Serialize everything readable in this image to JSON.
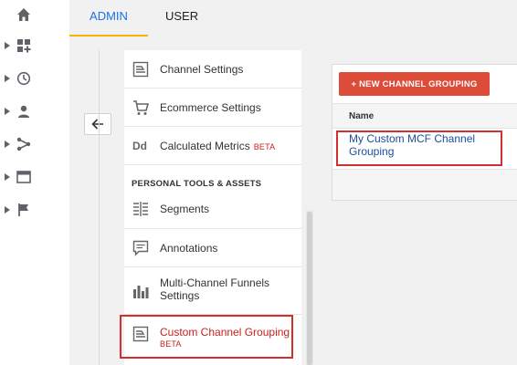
{
  "tabs": [
    {
      "label": "ADMIN",
      "active": true
    },
    {
      "label": "USER",
      "active": false
    }
  ],
  "rail": {
    "icons": [
      "home-icon",
      "dashboard-icon",
      "clock-icon",
      "person-icon",
      "share-icon",
      "display-icon",
      "flag-icon"
    ]
  },
  "menu": {
    "items": [
      {
        "label": "Channel Settings",
        "icon": "channel-settings-icon"
      },
      {
        "label": "Ecommerce Settings",
        "icon": "cart-icon"
      },
      {
        "label": "Calculated Metrics",
        "badge": "BETA",
        "icon": "dd-icon"
      }
    ],
    "section_heading": "PERSONAL TOOLS & ASSETS",
    "personal_items": [
      {
        "label": "Segments",
        "icon": "segments-icon"
      },
      {
        "label": "Annotations",
        "icon": "annotation-icon"
      },
      {
        "label": "Multi-Channel Funnels Settings",
        "icon": "bar-chart-icon"
      },
      {
        "label": "Custom Channel Grouping",
        "badge": "BETA",
        "icon": "channel-grouping-icon",
        "active": true
      }
    ]
  },
  "panel": {
    "new_button": "+ NEW CHANNEL GROUPING",
    "column_name": "Name",
    "rows": [
      "My Custom MCF Channel Grouping"
    ]
  },
  "colors": {
    "accent_tab": "#1a73e8",
    "tab_underline": "#f4b400",
    "button_red": "#dd4b39",
    "highlight": "#d32f2f",
    "link": "#1a4fa0"
  }
}
